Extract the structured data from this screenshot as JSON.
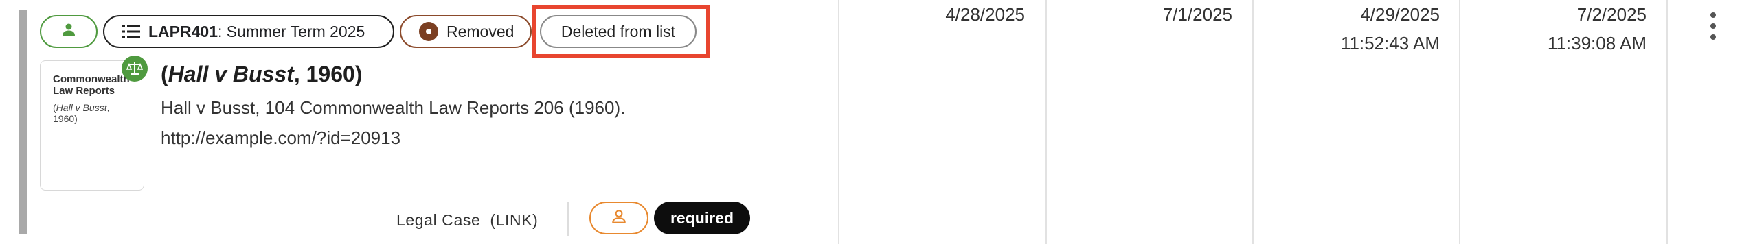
{
  "chips": {
    "course_code": "LAPR401",
    "course_term": ": Summer Term 2025",
    "removed_label": "Removed",
    "deleted_label": "Deleted from list"
  },
  "item": {
    "thumb_title": "Commonwealth Law Reports",
    "thumb_subtitle_italic": "Hall v Busst",
    "thumb_subtitle_rest": ", 1960)",
    "title_open": "(",
    "title_italic": "Hall v Busst",
    "title_rest": ", 1960)",
    "citation": "Hall v Busst, 104 Commonwealth Law Reports 206 (1960).",
    "url": "http://example.com/?id=20913",
    "type_label": "Legal Case",
    "type_link": "(LINK)",
    "required_label": "required"
  },
  "dates": {
    "col1": "4/28/2025",
    "col2": "7/1/2025",
    "col3_date": "4/29/2025",
    "col3_time": "11:52:43 AM",
    "col4_date": "7/2/2025",
    "col4_time": "11:39:08 AM"
  },
  "icons": [
    "person-icon",
    "list-icon",
    "removed-status-icon",
    "balance-scale-icon",
    "person-outline-icon",
    "more-vert-icon"
  ],
  "colors": {
    "highlight": "#e8452f",
    "green": "#4f9a3f",
    "removed": "#7b3f22",
    "orange": "#e8892f"
  }
}
